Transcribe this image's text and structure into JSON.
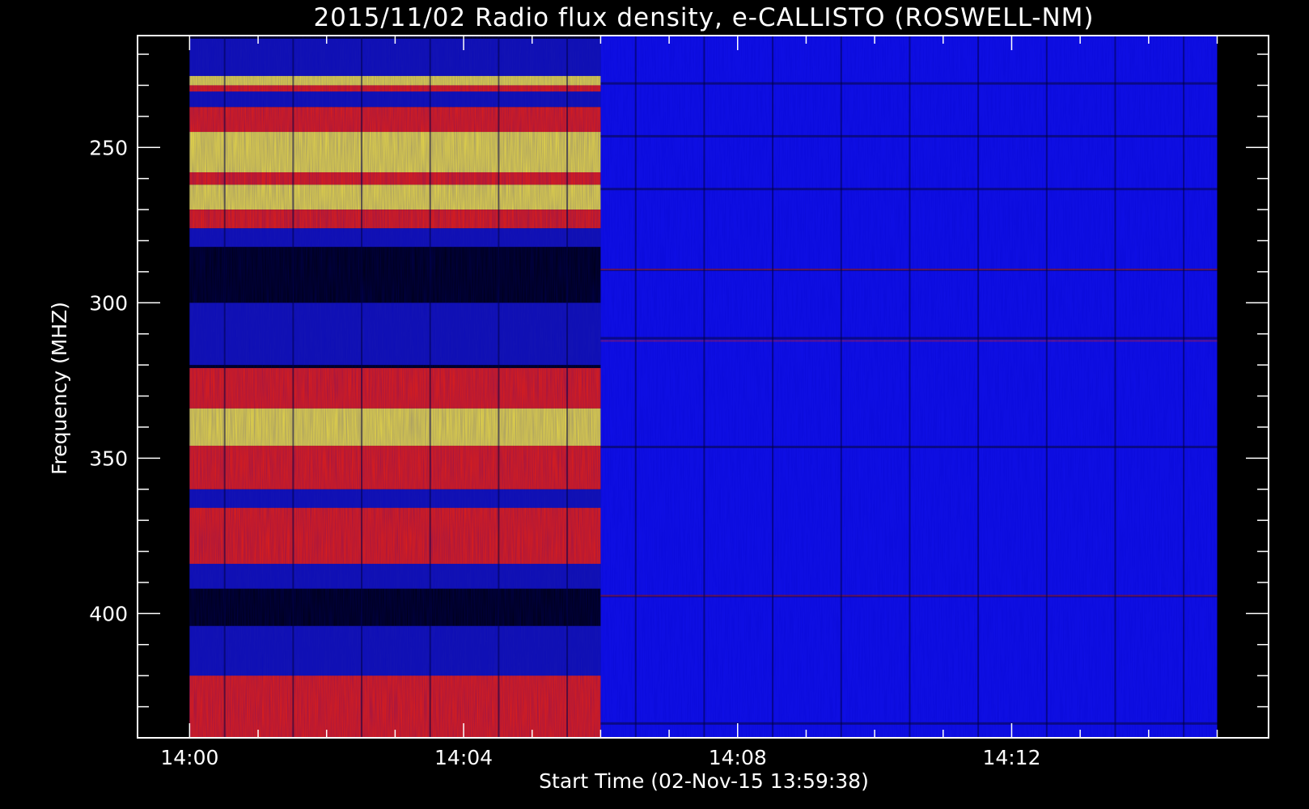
{
  "chart_data": {
    "type": "heatmap",
    "title": "2015/11/02  Radio flux density, e-CALLISTO (ROSWELL-NM)",
    "xlabel": "Start Time (02-Nov-15 13:59:38)",
    "ylabel": "Frequency (MHZ)",
    "x_ticks": [
      "14:00",
      "14:04",
      "14:08",
      "14:12"
    ],
    "y_ticks": [
      "250",
      "300",
      "350",
      "400"
    ],
    "ylim": [
      440,
      214
    ],
    "xlim_minutes_after_1400": [
      -0.76,
      15.75
    ],
    "data_time_range_minutes_after_1400": [
      0,
      15
    ],
    "transition_minute": 6.0,
    "grid": false,
    "colors": {
      "background": "#000000",
      "axes": "#ffffff",
      "low": "#1010e8",
      "mid": "#e82010",
      "high": "#f0e040"
    },
    "intensity_bands_mhz": [
      {
        "from": 227,
        "to": 230,
        "level": "high"
      },
      {
        "from": 230,
        "to": 232,
        "level": "mid"
      },
      {
        "from": 237,
        "to": 245,
        "level": "mid"
      },
      {
        "from": 245,
        "to": 258,
        "level": "high"
      },
      {
        "from": 258,
        "to": 262,
        "level": "mid"
      },
      {
        "from": 262,
        "to": 270,
        "level": "high"
      },
      {
        "from": 270,
        "to": 276,
        "level": "mid"
      },
      {
        "from": 321,
        "to": 334,
        "level": "mid"
      },
      {
        "from": 334,
        "to": 346,
        "level": "high"
      },
      {
        "from": 346,
        "to": 360,
        "level": "mid"
      },
      {
        "from": 366,
        "to": 384,
        "level": "mid"
      },
      {
        "from": 420,
        "to": 440,
        "level": "mid"
      }
    ]
  }
}
